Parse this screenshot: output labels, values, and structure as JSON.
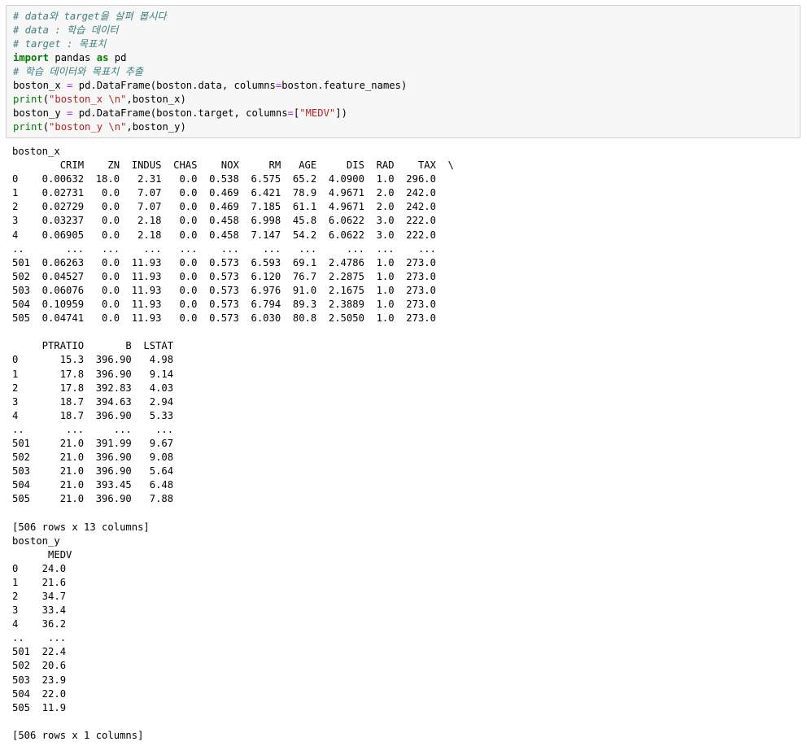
{
  "code_cell": {
    "lines": [
      [
        {
          "t": "# data와 target을 살펴 봅시다",
          "c": "comment"
        }
      ],
      [
        {
          "t": "# data : 학습 데이터",
          "c": "comment"
        }
      ],
      [
        {
          "t": "# target : 목표치",
          "c": "comment"
        }
      ],
      [
        {
          "t": "import",
          "c": "kw"
        },
        {
          "t": " pandas ",
          "c": "plain"
        },
        {
          "t": "as",
          "c": "kw"
        },
        {
          "t": " pd",
          "c": "plain"
        }
      ],
      [
        {
          "t": "# 학습 데이터와 목표치 추출",
          "c": "comment"
        }
      ],
      [
        {
          "t": "boston_x ",
          "c": "plain"
        },
        {
          "t": "=",
          "c": "op"
        },
        {
          "t": " pd.DataFrame(boston.data, columns",
          "c": "plain"
        },
        {
          "t": "=",
          "c": "op"
        },
        {
          "t": "boston.feature_names)",
          "c": "plain"
        }
      ],
      [
        {
          "t": "print",
          "c": "fn"
        },
        {
          "t": "(",
          "c": "plain"
        },
        {
          "t": "\"boston_x \\n\"",
          "c": "str"
        },
        {
          "t": ",boston_x)",
          "c": "plain"
        }
      ],
      [
        {
          "t": "boston_y ",
          "c": "plain"
        },
        {
          "t": "=",
          "c": "op"
        },
        {
          "t": " pd.DataFrame(boston.target, columns",
          "c": "plain"
        },
        {
          "t": "=",
          "c": "op"
        },
        {
          "t": "[",
          "c": "plain"
        },
        {
          "t": "\"MEDV\"",
          "c": "str"
        },
        {
          "t": "])",
          "c": "plain"
        }
      ],
      [
        {
          "t": "print",
          "c": "fn"
        },
        {
          "t": "(",
          "c": "plain"
        },
        {
          "t": "\"boston_y \\n\"",
          "c": "str"
        },
        {
          "t": ",boston_y)",
          "c": "plain"
        }
      ]
    ]
  },
  "output": {
    "lines": [
      "boston_x",
      "        CRIM    ZN  INDUS  CHAS    NOX     RM   AGE     DIS  RAD    TAX  \\",
      "0    0.00632  18.0   2.31   0.0  0.538  6.575  65.2  4.0900  1.0  296.0",
      "1    0.02731   0.0   7.07   0.0  0.469  6.421  78.9  4.9671  2.0  242.0",
      "2    0.02729   0.0   7.07   0.0  0.469  7.185  61.1  4.9671  2.0  242.0",
      "3    0.03237   0.0   2.18   0.0  0.458  6.998  45.8  6.0622  3.0  222.0",
      "4    0.06905   0.0   2.18   0.0  0.458  7.147  54.2  6.0622  3.0  222.0",
      "..       ...   ...    ...   ...    ...    ...   ...     ...  ...    ...",
      "501  0.06263   0.0  11.93   0.0  0.573  6.593  69.1  2.4786  1.0  273.0",
      "502  0.04527   0.0  11.93   0.0  0.573  6.120  76.7  2.2875  1.0  273.0",
      "503  0.06076   0.0  11.93   0.0  0.573  6.976  91.0  2.1675  1.0  273.0",
      "504  0.10959   0.0  11.93   0.0  0.573  6.794  89.3  2.3889  1.0  273.0",
      "505  0.04741   0.0  11.93   0.0  0.573  6.030  80.8  2.5050  1.0  273.0",
      "",
      "     PTRATIO       B  LSTAT",
      "0       15.3  396.90   4.98",
      "1       17.8  396.90   9.14",
      "2       17.8  392.83   4.03",
      "3       18.7  394.63   2.94",
      "4       18.7  396.90   5.33",
      "..       ...     ...    ...",
      "501     21.0  391.99   9.67",
      "502     21.0  396.90   9.08",
      "503     21.0  396.90   5.64",
      "504     21.0  393.45   6.48",
      "505     21.0  396.90   7.88",
      "",
      "[506 rows x 13 columns]",
      "boston_y",
      "      MEDV",
      "0    24.0",
      "1    21.6",
      "2    34.7",
      "3    33.4",
      "4    36.2",
      "..    ...",
      "501  22.4",
      "502  20.6",
      "503  23.9",
      "504  22.0",
      "505  11.9",
      "",
      "[506 rows x 1 columns]"
    ]
  },
  "colors": {
    "cell_background": "#f7f7f7",
    "cell_border": "#cfcfcf",
    "comment": "#408080",
    "keyword": "#008000",
    "operator": "#aa22ff",
    "string": "#ba2121"
  }
}
